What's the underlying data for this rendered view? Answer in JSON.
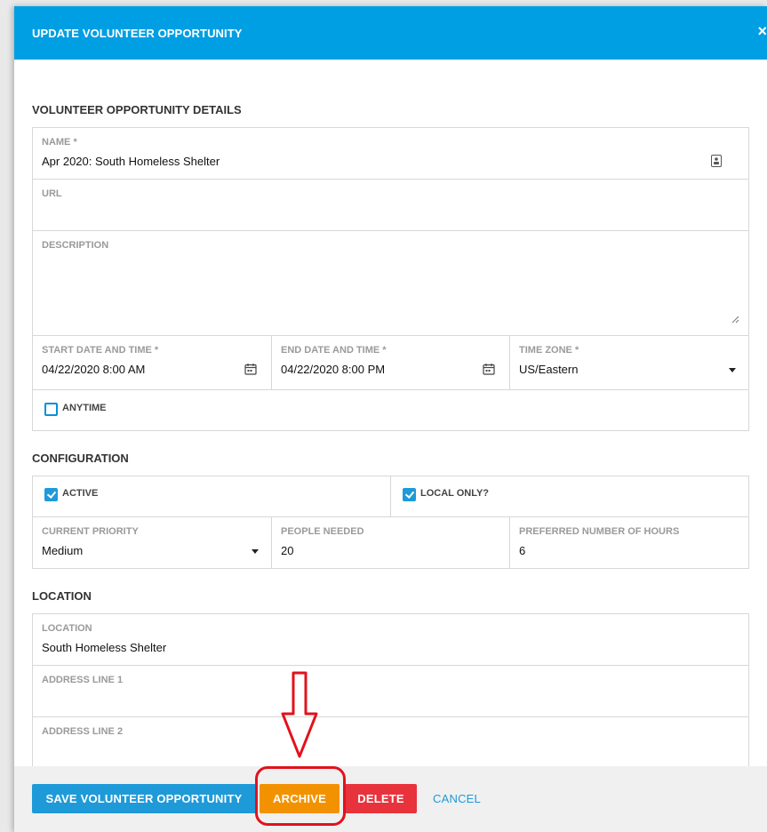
{
  "header": {
    "title": "UPDATE VOLUNTEER OPPORTUNITY",
    "close_glyph": "×"
  },
  "details": {
    "section_title": "VOLUNTEER OPPORTUNITY DETAILS",
    "name": {
      "label": "NAME *",
      "value": "Apr 2020: South  Homeless Shelter"
    },
    "url": {
      "label": "URL",
      "value": ""
    },
    "description": {
      "label": "DESCRIPTION",
      "value": ""
    },
    "start": {
      "label": "START DATE AND TIME *",
      "value": "04/22/2020 8:00 AM"
    },
    "end": {
      "label": "END DATE AND TIME *",
      "value": "04/22/2020 8:00 PM"
    },
    "timezone": {
      "label": "TIME ZONE *",
      "value": "US/Eastern"
    },
    "anytime": {
      "label": "ANYTIME",
      "checked": false
    }
  },
  "configuration": {
    "section_title": "CONFIGURATION",
    "active": {
      "label": "ACTIVE",
      "checked": true
    },
    "local_only": {
      "label": "LOCAL ONLY?",
      "checked": true
    },
    "priority": {
      "label": "CURRENT PRIORITY",
      "value": "Medium"
    },
    "people_needed": {
      "label": "PEOPLE NEEDED",
      "value": "20"
    },
    "hours": {
      "label": "PREFERRED NUMBER OF HOURS",
      "value": "6"
    }
  },
  "location": {
    "section_title": "LOCATION",
    "location": {
      "label": "LOCATION",
      "value": "South  Homeless Shelter"
    },
    "address1": {
      "label": "ADDRESS LINE 1",
      "value": ""
    },
    "address2": {
      "label": "ADDRESS LINE 2",
      "value": ""
    }
  },
  "footer": {
    "save_label": "SAVE VOLUNTEER OPPORTUNITY",
    "archive_label": "ARCHIVE",
    "delete_label": "DELETE",
    "cancel_label": "CANCEL"
  },
  "colors": {
    "header": "#009fe3",
    "save": "#1e9ad8",
    "archive": "#f39200",
    "delete": "#e8323c",
    "cancel_text": "#1e9ad8",
    "annotation": "#e1121c"
  }
}
